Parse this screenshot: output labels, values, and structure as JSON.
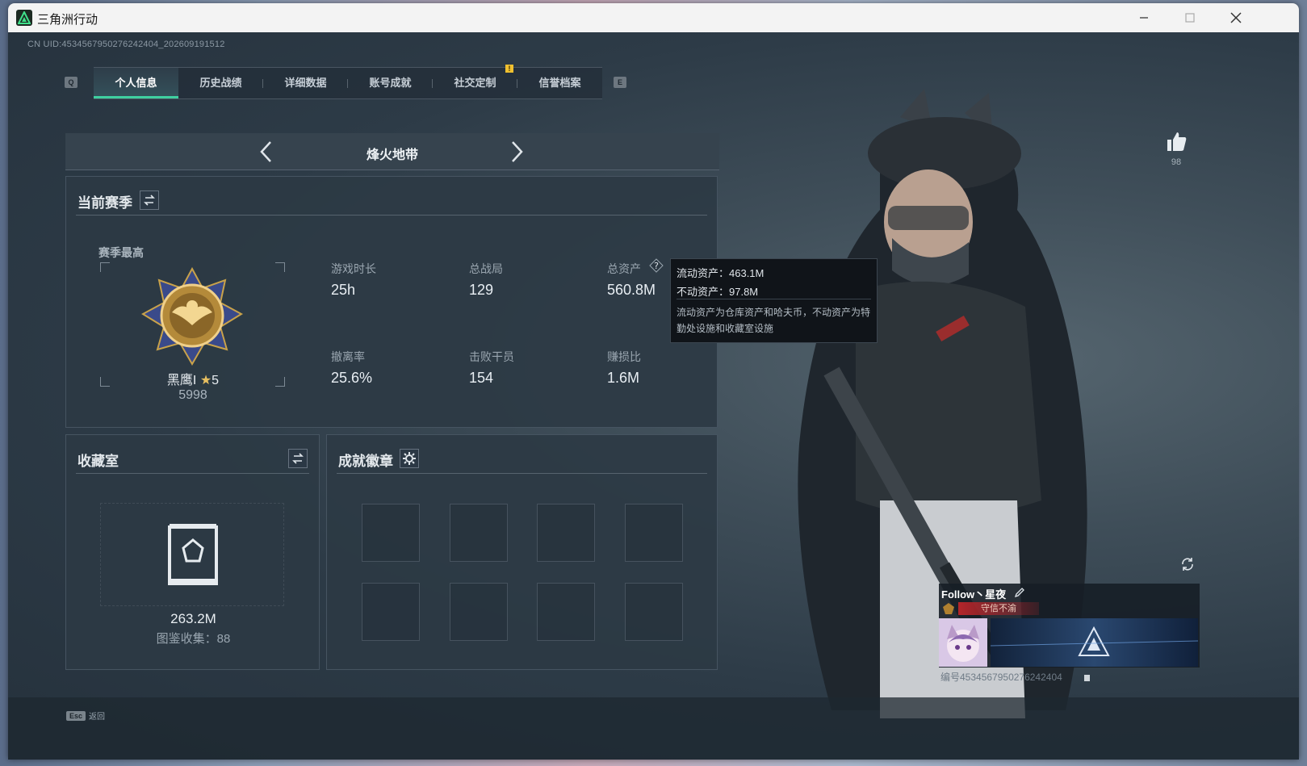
{
  "window": {
    "title": "三角洲行动"
  },
  "uid": "CN UID:4534567950276242404_202609191512",
  "tabs": {
    "left_key": "Q",
    "right_key": "E",
    "items": [
      {
        "label": "个人信息"
      },
      {
        "label": "历史战绩"
      },
      {
        "label": "详细数据"
      },
      {
        "label": "账号成就"
      },
      {
        "label": "社交定制"
      },
      {
        "label": "信誉档案"
      }
    ],
    "notification": "!"
  },
  "mode": {
    "label": "烽火地带"
  },
  "season": {
    "title": "当前赛季",
    "best_label": "赛季最高",
    "rank_name": "黑鹰I",
    "rank_stars": "5",
    "rank_score": "5998",
    "stats": [
      {
        "label": "游戏时长",
        "value": "25h"
      },
      {
        "label": "总战局",
        "value": "129"
      },
      {
        "label": "总资产",
        "value": "560.8M"
      },
      {
        "label": "撤离率",
        "value": "25.6%"
      },
      {
        "label": "击败干员",
        "value": "154"
      },
      {
        "label": "赚损比",
        "value": "1.6M"
      }
    ]
  },
  "tooltip": {
    "liquid": "流动资产：463.1M",
    "fixed": "不动资产：97.8M",
    "desc": "流动资产为仓库资产和哈夫币，不动资产为特勤处设施和收藏室设施"
  },
  "collection": {
    "title": "收藏室",
    "value": "263.2M",
    "catalog": "图鉴收集：88"
  },
  "achievements": {
    "title": "成就徽章"
  },
  "likes": {
    "count": "98"
  },
  "profile": {
    "name": "Follow丶星夜",
    "title": "守信不渝",
    "id": "编号4534567950276242404"
  },
  "bottom": {
    "esc_key": "Esc",
    "back_label": "返回"
  },
  "colors": {
    "accent": "#3fd0a0",
    "tooltip_bg": "#101419",
    "panel_bg": "#2c3944"
  }
}
